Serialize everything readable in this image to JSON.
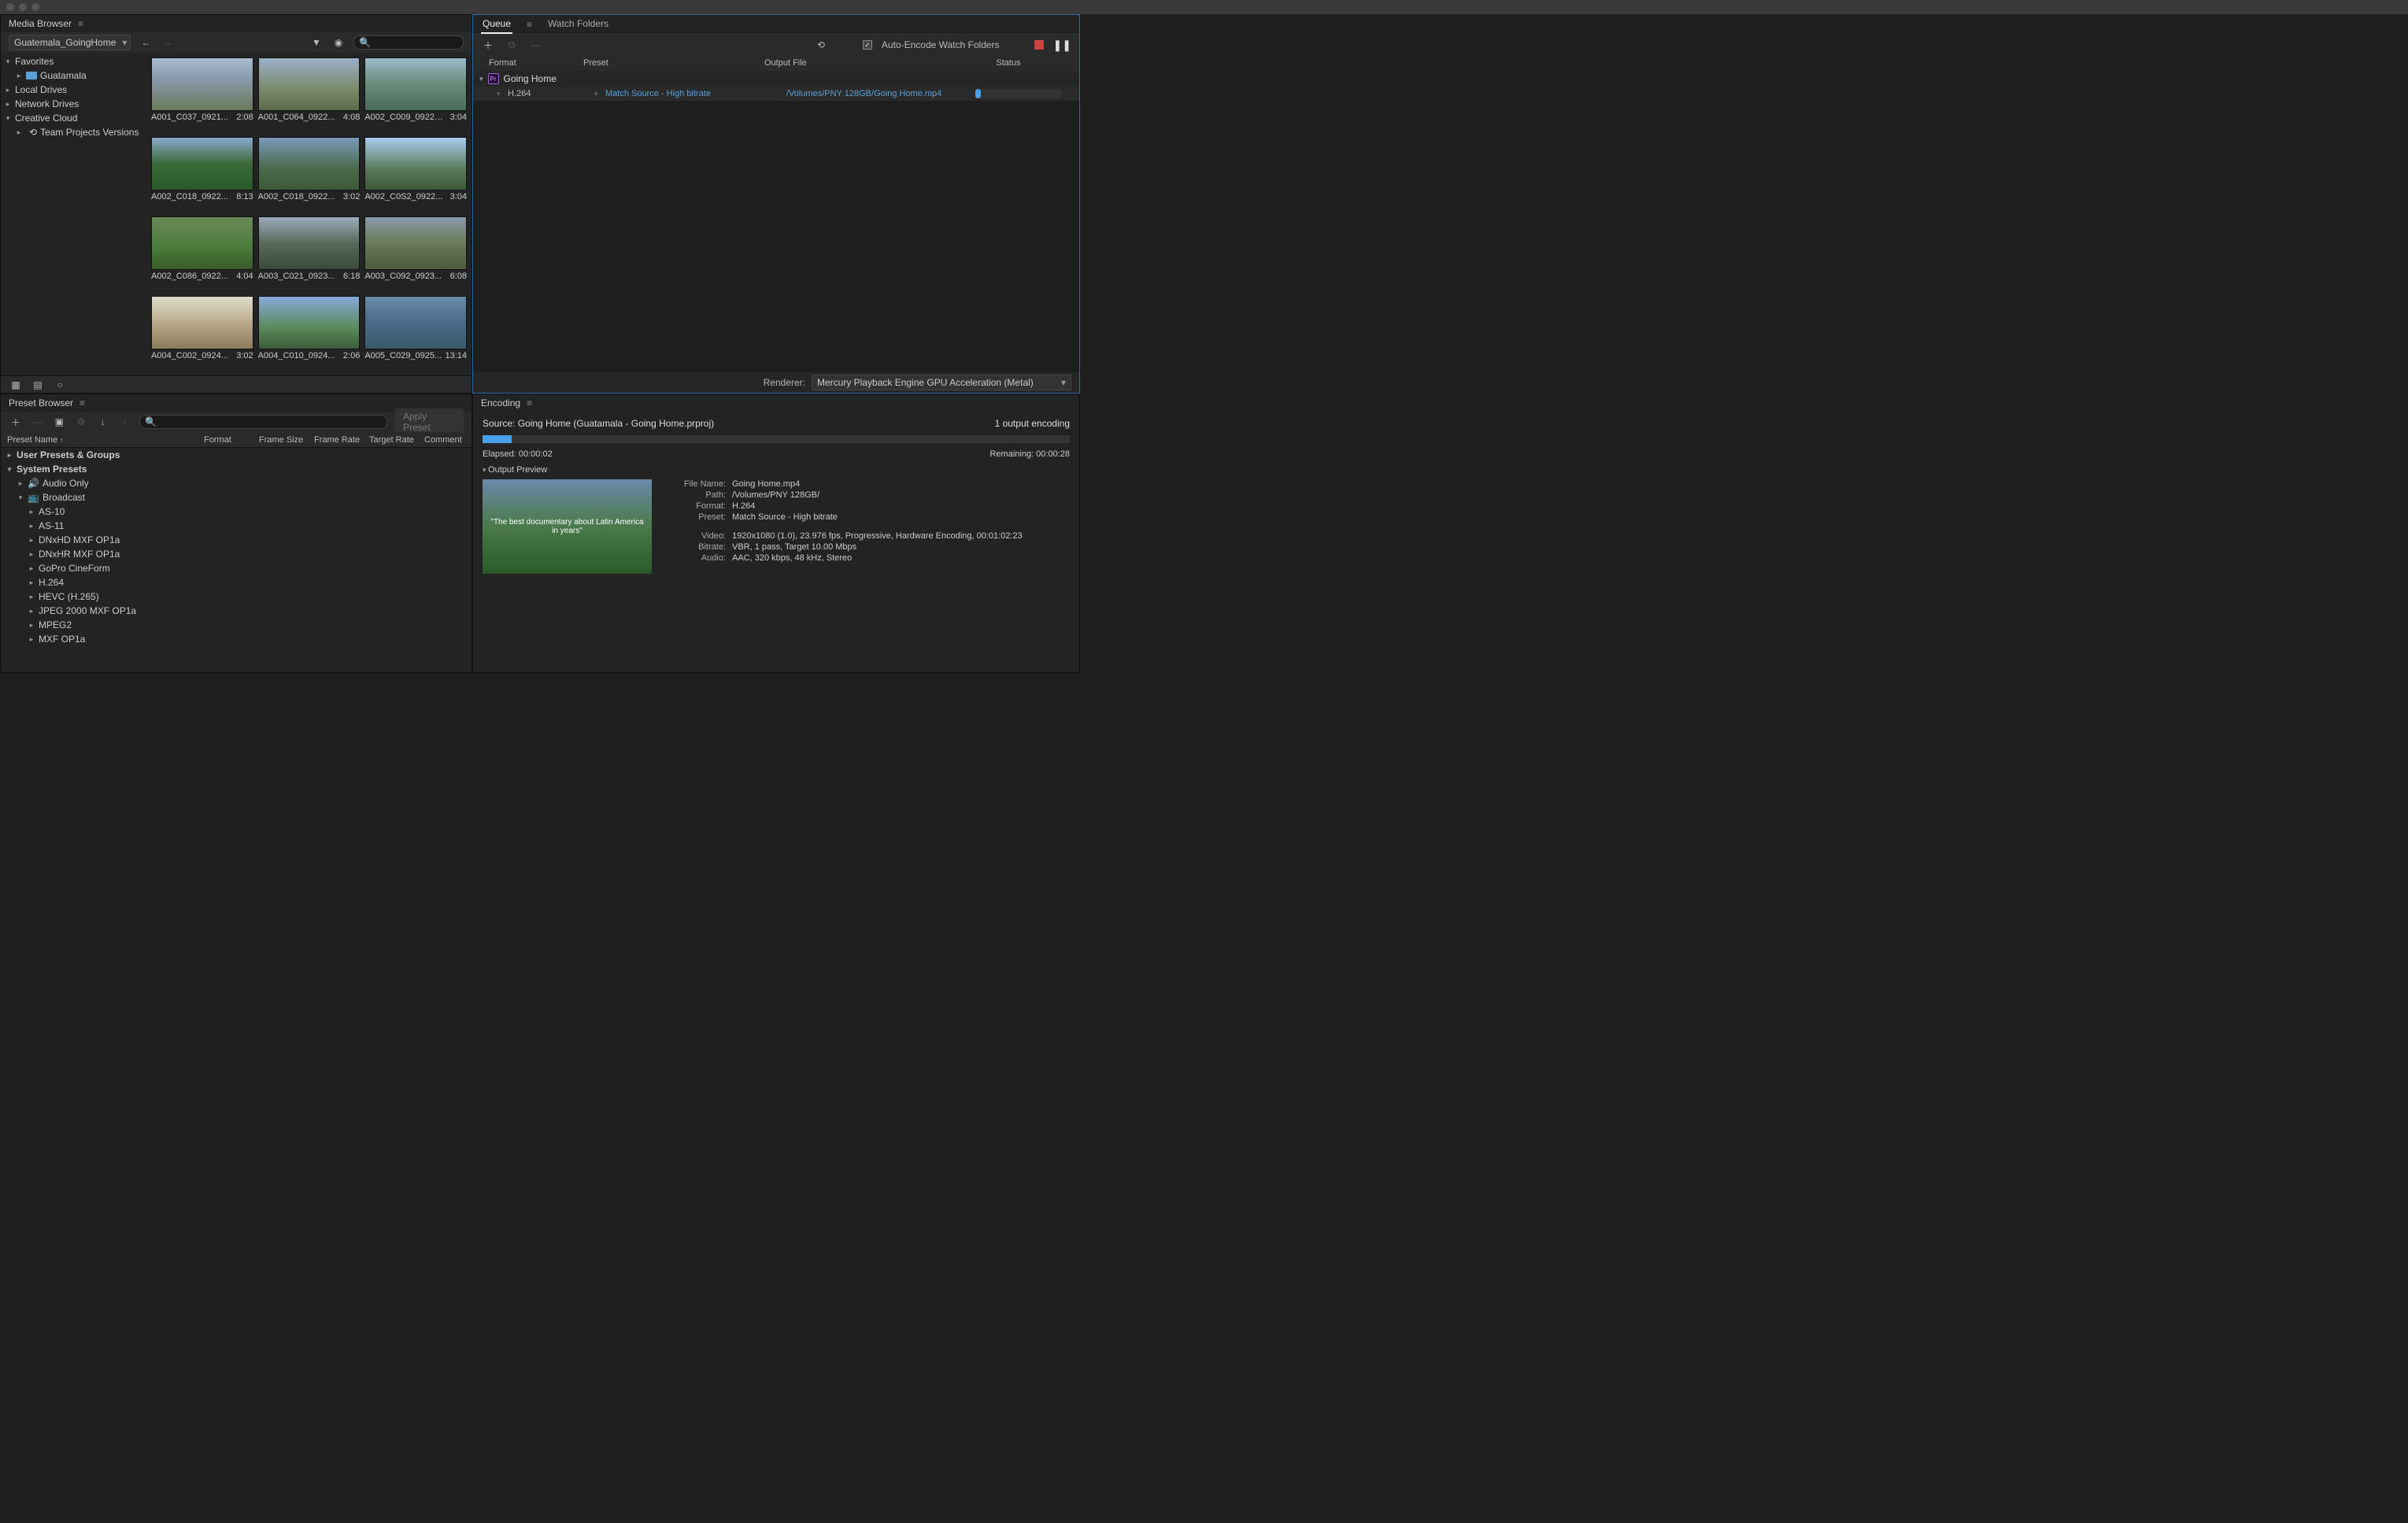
{
  "mediaBrowser": {
    "title": "Media Browser",
    "project": "Guatemala_GoingHome",
    "tree": {
      "favorites": "Favorites",
      "guatamala": "Guatamala",
      "localDrives": "Local Drives",
      "networkDrives": "Network Drives",
      "creativeCloud": "Creative Cloud",
      "teamProjects": "Team Projects Versions"
    },
    "clips": [
      {
        "name": "A001_C037_0921...",
        "dur": "2:08"
      },
      {
        "name": "A001_C064_0922...",
        "dur": "4:08"
      },
      {
        "name": "A002_C009_09222...",
        "dur": "3:04"
      },
      {
        "name": "A002_C018_0922...",
        "dur": "8:13"
      },
      {
        "name": "A002_C018_0922...",
        "dur": "3:02"
      },
      {
        "name": "A002_C0S2_0922...",
        "dur": "3:04"
      },
      {
        "name": "A002_C086_0922...",
        "dur": "4:04"
      },
      {
        "name": "A003_C021_0923...",
        "dur": "6:18"
      },
      {
        "name": "A003_C092_0923...",
        "dur": "6:08"
      },
      {
        "name": "A004_C002_0924...",
        "dur": "3:02"
      },
      {
        "name": "A004_C010_0924...",
        "dur": "2:06"
      },
      {
        "name": "A005_C029_0925...",
        "dur": "13:14"
      }
    ]
  },
  "presetBrowser": {
    "title": "Preset Browser",
    "applyLabel": "Apply Preset",
    "headers": {
      "name": "Preset Name",
      "format": "Format",
      "frameSize": "Frame Size",
      "frameRate": "Frame Rate",
      "targetRate": "Target Rate",
      "comment": "Comment"
    },
    "groups": {
      "userPresets": "User Presets & Groups",
      "systemPresets": "System Presets",
      "audioOnly": "Audio Only",
      "broadcast": "Broadcast"
    },
    "items": [
      "AS-10",
      "AS-11",
      "DNxHD MXF OP1a",
      "DNxHR MXF OP1a",
      "GoPro CineForm",
      "H.264",
      "HEVC (H.265)",
      "JPEG 2000 MXF OP1a",
      "MPEG2",
      "MXF OP1a"
    ]
  },
  "queue": {
    "tabs": {
      "queue": "Queue",
      "watch": "Watch Folders"
    },
    "autoEncode": "Auto-Encode Watch Folders",
    "headers": {
      "format": "Format",
      "preset": "Preset",
      "output": "Output File",
      "status": "Status"
    },
    "job": {
      "name": "Going Home",
      "format": "H.264",
      "preset": "Match Source - High bitrate",
      "output": "/Volumes/PNY 128GB/Going Home.mp4"
    },
    "rendererLabel": "Renderer:",
    "renderer": "Mercury Playback Engine GPU Acceleration (Metal)"
  },
  "encoding": {
    "title": "Encoding",
    "source": "Source: Going Home (Guatamala - Going Home.prproj)",
    "outputCount": "1 output encoding",
    "elapsed": "Elapsed: 00:00:02",
    "remaining": "Remaining: 00:00:28",
    "previewLabel": "Output Preview",
    "thumbText": "\"The best documentary about Latin America in years\"",
    "meta": {
      "fileNameLabel": "File Name:",
      "fileName": "Going Home.mp4",
      "pathLabel": "Path:",
      "path": "/Volumes/PNY 128GB/",
      "formatLabel": "Format:",
      "format": "H.264",
      "presetLabel": "Preset:",
      "preset": "Match Source - High bitrate",
      "videoLabel": "Video:",
      "video": "1920x1080 (1.0), 23.976 fps, Progressive, Hardware Encoding, 00:01:02:23",
      "bitrateLabel": "Bitrate:",
      "bitrate": "VBR, 1 pass, Target 10.00 Mbps",
      "audioLabel": "Audio:",
      "audio": "AAC, 320 kbps, 48 kHz, Stereo"
    }
  }
}
